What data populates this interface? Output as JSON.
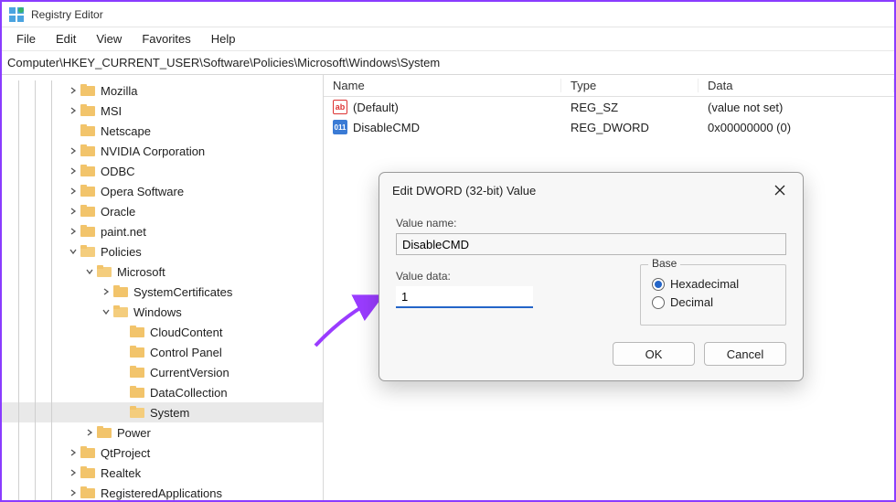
{
  "window": {
    "title": "Registry Editor"
  },
  "menubar": [
    "File",
    "Edit",
    "View",
    "Favorites",
    "Help"
  ],
  "path": "Computer\\HKEY_CURRENT_USER\\Software\\Policies\\Microsoft\\Windows\\System",
  "tree": [
    {
      "depth": 4,
      "chev": ">",
      "label": "Mozilla",
      "open": false
    },
    {
      "depth": 4,
      "chev": ">",
      "label": "MSI",
      "open": false
    },
    {
      "depth": 4,
      "chev": "",
      "label": "Netscape",
      "open": false
    },
    {
      "depth": 4,
      "chev": ">",
      "label": "NVIDIA Corporation",
      "open": false
    },
    {
      "depth": 4,
      "chev": ">",
      "label": "ODBC",
      "open": false
    },
    {
      "depth": 4,
      "chev": ">",
      "label": "Opera Software",
      "open": false
    },
    {
      "depth": 4,
      "chev": ">",
      "label": "Oracle",
      "open": false
    },
    {
      "depth": 4,
      "chev": ">",
      "label": "paint.net",
      "open": false
    },
    {
      "depth": 4,
      "chev": "v",
      "label": "Policies",
      "open": true
    },
    {
      "depth": 5,
      "chev": "v",
      "label": "Microsoft",
      "open": true
    },
    {
      "depth": 6,
      "chev": ">",
      "label": "SystemCertificates",
      "open": false
    },
    {
      "depth": 6,
      "chev": "v",
      "label": "Windows",
      "open": true
    },
    {
      "depth": 7,
      "chev": "",
      "label": "CloudContent",
      "open": false
    },
    {
      "depth": 7,
      "chev": "",
      "label": "Control Panel",
      "open": false
    },
    {
      "depth": 7,
      "chev": "",
      "label": "CurrentVersion",
      "open": false
    },
    {
      "depth": 7,
      "chev": "",
      "label": "DataCollection",
      "open": false
    },
    {
      "depth": 7,
      "chev": "",
      "label": "System",
      "open": true,
      "selected": true
    },
    {
      "depth": 5,
      "chev": ">",
      "label": "Power",
      "open": false
    },
    {
      "depth": 4,
      "chev": ">",
      "label": "QtProject",
      "open": false
    },
    {
      "depth": 4,
      "chev": ">",
      "label": "Realtek",
      "open": false
    },
    {
      "depth": 4,
      "chev": ">",
      "label": "RegisteredApplications",
      "open": false
    }
  ],
  "list": {
    "headers": {
      "name": "Name",
      "type": "Type",
      "data": "Data"
    },
    "rows": [
      {
        "icon": "sz",
        "name": "(Default)",
        "type": "REG_SZ",
        "data": "(value not set)"
      },
      {
        "icon": "dw",
        "name": "DisableCMD",
        "type": "REG_DWORD",
        "data": "0x00000000 (0)"
      }
    ]
  },
  "dialog": {
    "title": "Edit DWORD (32-bit) Value",
    "value_name_label": "Value name:",
    "value_name": "DisableCMD",
    "value_data_label": "Value data:",
    "value_data": "1",
    "base_label": "Base",
    "radio_hex": "Hexadecimal",
    "radio_dec": "Decimal",
    "base_selected": "hex",
    "ok": "OK",
    "cancel": "Cancel"
  }
}
